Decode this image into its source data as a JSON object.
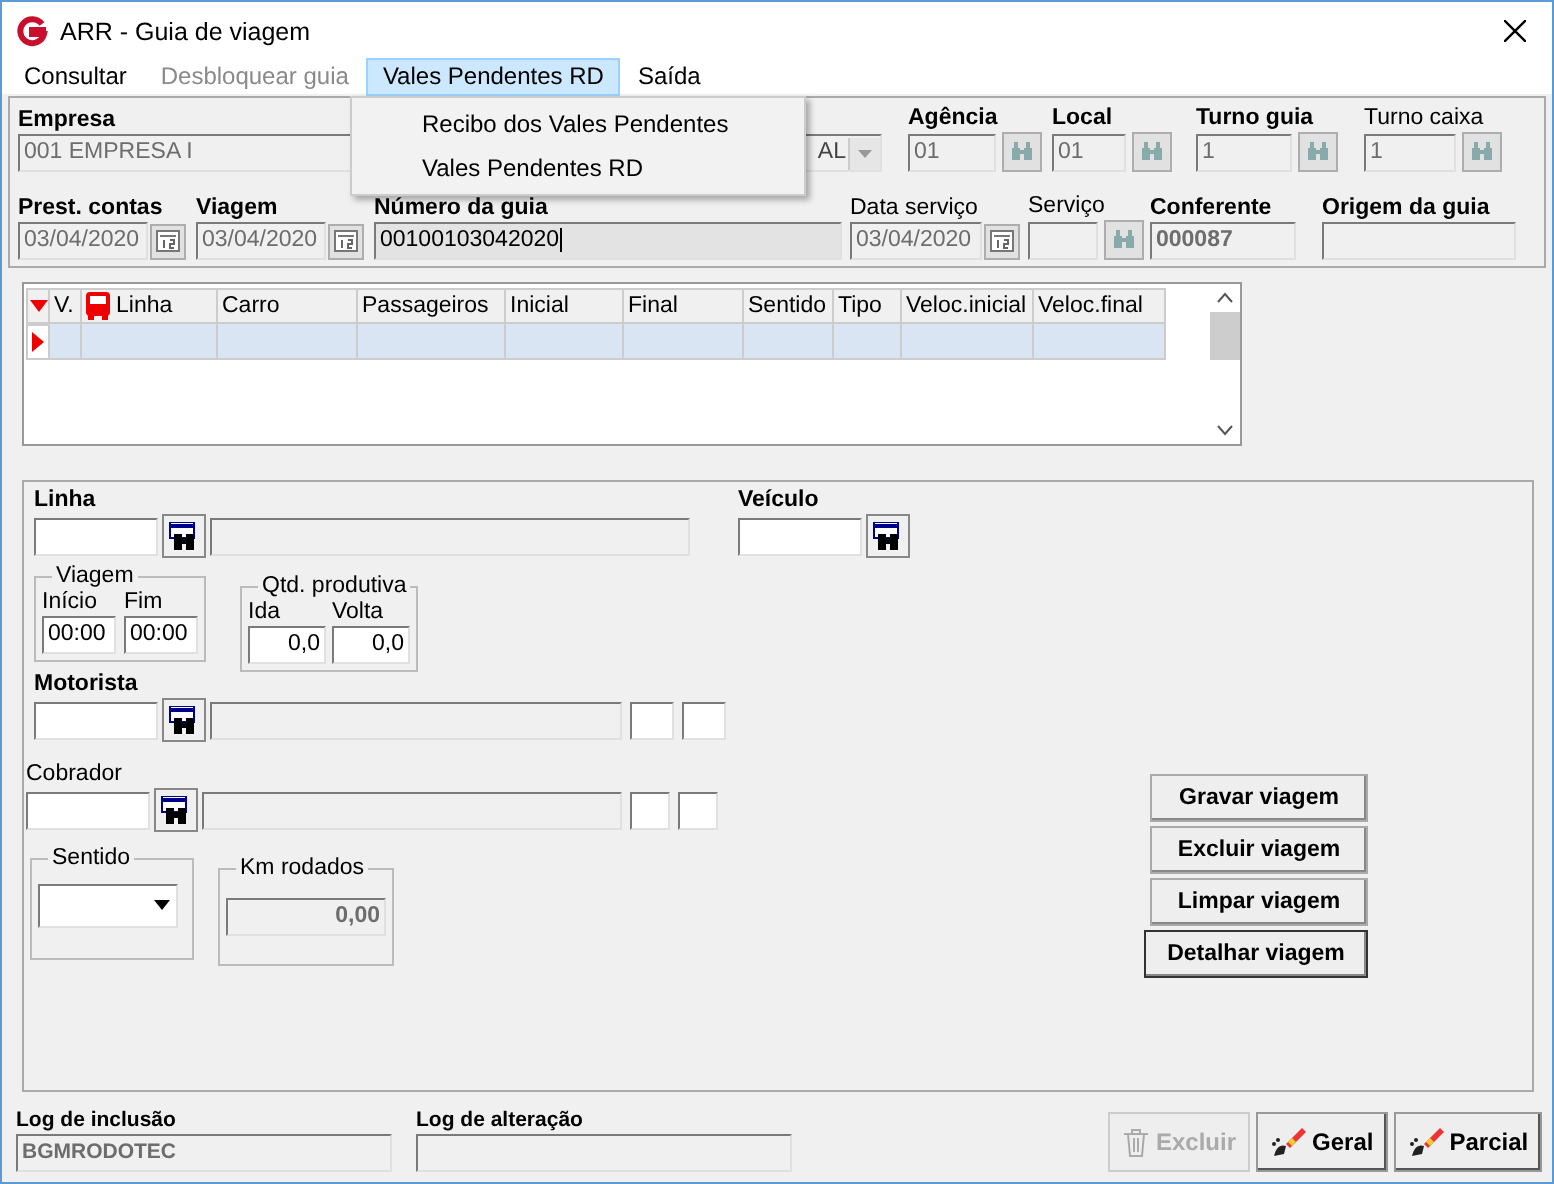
{
  "window": {
    "title": "ARR - Guia de viagem"
  },
  "menu": [
    {
      "label": "Consultar",
      "disabled": false,
      "selected": false
    },
    {
      "label": "Desbloquear guia",
      "disabled": true,
      "selected": false
    },
    {
      "label": "Vales Pendentes RD",
      "disabled": false,
      "selected": true
    },
    {
      "label": "Saída",
      "disabled": false,
      "selected": false
    }
  ],
  "open_menu": {
    "items": [
      "Recibo dos Vales Pendentes",
      "Vales Pendentes RD"
    ]
  },
  "header_row1": [
    {
      "label": "Empresa",
      "bold": true,
      "kind": "combo",
      "value": "001 EMPRESA I",
      "value_2": "AL"
    },
    {
      "label": "Agência",
      "bold": true,
      "kind": "lookup",
      "value": "01"
    },
    {
      "label": "Local",
      "bold": true,
      "kind": "lookup",
      "value": "01"
    },
    {
      "label": "Turno guia",
      "bold": true,
      "kind": "lookup",
      "value": "1"
    },
    {
      "label": "Turno caixa",
      "bold": false,
      "kind": "lookup",
      "value": "1"
    }
  ],
  "header_row2": [
    {
      "label": "Prest. contas",
      "bold": true,
      "kind": "date",
      "value": "03/04/2020"
    },
    {
      "label": "Viagem",
      "bold": true,
      "kind": "date",
      "value": "03/04/2020"
    },
    {
      "label": "Número da guia",
      "bold": true,
      "kind": "text",
      "value": "00100103042020"
    },
    {
      "label": "Data serviço",
      "bold": false,
      "kind": "date",
      "value": "03/04/2020"
    },
    {
      "label": "Serviço",
      "bold": false,
      "kind": "lookup"
    },
    {
      "label": "Conferente",
      "bold": true,
      "kind": "readonly",
      "value": "000087"
    },
    {
      "label": "Origem da guia",
      "bold": true,
      "kind": "readonly"
    }
  ],
  "grid": {
    "columns": [
      {
        "label": "V."
      },
      {
        "label": "Linha",
        "kind": "bus"
      },
      {
        "label": "Carro"
      },
      {
        "label": "Passageiros"
      },
      {
        "label": "Inicial"
      },
      {
        "label": "Final"
      },
      {
        "label": "Sentido"
      },
      {
        "label": "Tipo"
      },
      {
        "label": "Veloc.inicial"
      },
      {
        "label": "Veloc.final"
      }
    ],
    "rows": [
      {
        "selected": true
      }
    ]
  },
  "trip": {
    "linha": {
      "label": "Linha",
      "bold": true
    },
    "veiculo": {
      "label": "Veículo",
      "bold": true
    },
    "viagem": {
      "title": "Viagem",
      "inicio": {
        "label": "Início",
        "value": "00:00"
      },
      "fim": {
        "label": "Fim",
        "value": "00:00"
      }
    },
    "qtd": {
      "title": "Qtd. produtiva",
      "ida": {
        "label": "Ida",
        "value": "0,0"
      },
      "volta": {
        "label": "Volta",
        "value": "0,0"
      }
    },
    "motorista": {
      "label": "Motorista",
      "bold": true
    },
    "cobrador": {
      "label": "Cobrador",
      "bold": false
    },
    "sentido": {
      "title": "Sentido"
    },
    "km": {
      "title": "Km rodados",
      "value": "0,00"
    }
  },
  "actions": [
    {
      "label": "Gravar viagem",
      "focused": false
    },
    {
      "label": "Excluir viagem",
      "focused": false
    },
    {
      "label": "Limpar viagem",
      "focused": false
    },
    {
      "label": "Detalhar viagem",
      "focused": true
    }
  ],
  "logs": [
    {
      "label": "Log de inclusão",
      "value": "BGMRODOTEC"
    },
    {
      "label": "Log de alteração"
    }
  ],
  "footer_buttons": [
    {
      "label": "Excluir",
      "disabled": true,
      "kind": "trash"
    },
    {
      "label": "Geral",
      "disabled": false,
      "kind": "brush"
    },
    {
      "label": "Parcial",
      "disabled": false,
      "kind": "brush"
    }
  ]
}
